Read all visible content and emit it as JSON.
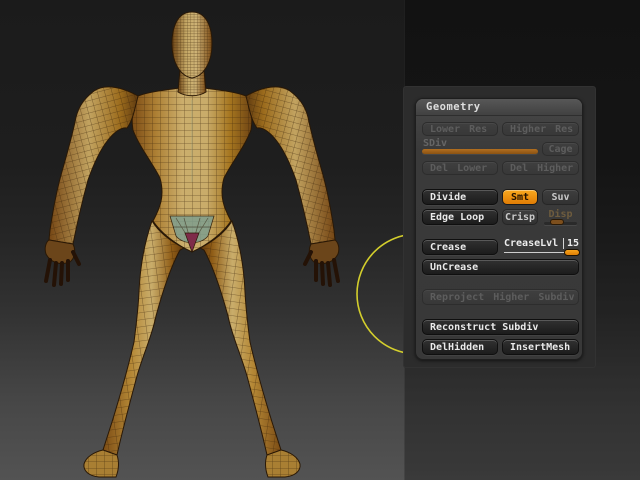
{
  "colors": {
    "accent_orange": "#f0930e",
    "panel_bg": "#3b3b3b",
    "canvas_top": "#1b1b1b",
    "canvas_bottom": "#535353",
    "brush_ring_yellow": "#dcd72c",
    "mesh_tan": "#cbae6c",
    "mesh_orange": "#a5751f",
    "pelvis_teal": "#7f9e8e",
    "crotch_magenta": "#7e2c49"
  },
  "viewport": {
    "model": "humanoid-base-mesh-polyframe-front-view"
  },
  "geometry_panel": {
    "title": "Geometry",
    "lower_res": "Lower Res",
    "higher_res": "Higher Res",
    "sdiv_label": "SDiv",
    "cage": "Cage",
    "del_lower": "Del Lower",
    "del_higher": "Del Higher",
    "divide": "Divide",
    "smt": "Smt",
    "suv": "Suv",
    "edge_loop": "Edge Loop",
    "crisp": "Crisp",
    "disp_label": "Disp",
    "crease": "Crease",
    "crease_lvl_label": "CreaseLvl",
    "crease_lvl_value": "15",
    "uncrease": "UnCrease",
    "reproject": "Reproject Higher Subdiv",
    "reconstruct": "Reconstruct Subdiv",
    "del_hidden": "DelHidden",
    "insert_mesh": "InsertMesh",
    "disabled_controls": [
      "Lower Res",
      "Higher Res",
      "SDiv",
      "Cage",
      "Del Lower",
      "Del Higher",
      "Disp",
      "Reproject Higher Subdiv"
    ],
    "active_toggle": "Smt"
  }
}
